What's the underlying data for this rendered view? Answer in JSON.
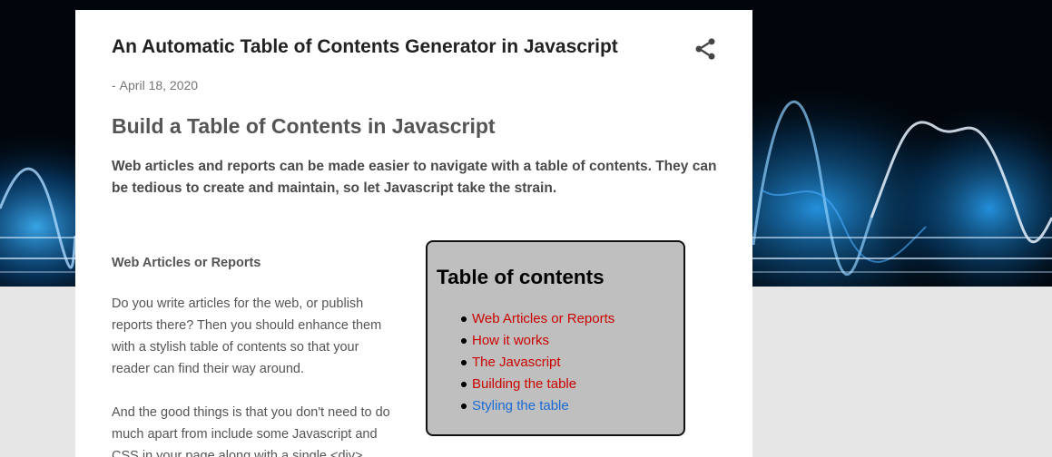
{
  "post": {
    "title": "An Automatic Table of Contents Generator in Javascript",
    "date_prefix": "-",
    "date": "April 18, 2020",
    "heading": "Build a Table of Contents in Javascript",
    "lead": "Web articles and reports can be made easier to navigate with a table of contents. They can be tedious to create and maintain, so let Javascript take the strain.",
    "section_heading": "Web Articles or Reports",
    "paragraph1": "Do you write articles for the web, or publish reports there? Then you should enhance them with a stylish table of contents so that your reader can find their way around.",
    "paragraph2": "And the good things is that you don't need to do much apart from include some Javascript and CSS in your page along with a single <div>"
  },
  "share": {
    "icon": "share-icon"
  },
  "toc": {
    "title": "Table of contents",
    "items": [
      {
        "label": "Web Articles or Reports",
        "color": "#cc0000"
      },
      {
        "label": "How it works",
        "color": "#cc0000"
      },
      {
        "label": "The Javascript",
        "color": "#cc0000"
      },
      {
        "label": "Building the table",
        "color": "#cc0000"
      },
      {
        "label": "Styling the table",
        "color": "#1a6bd6"
      }
    ]
  },
  "colors": {
    "page_background": "#e6e6e6",
    "toc_background": "#bfbfbf",
    "link": "#cc0000",
    "link_alt": "#1a6bd6",
    "banner_glow": "#2aa8ff"
  }
}
